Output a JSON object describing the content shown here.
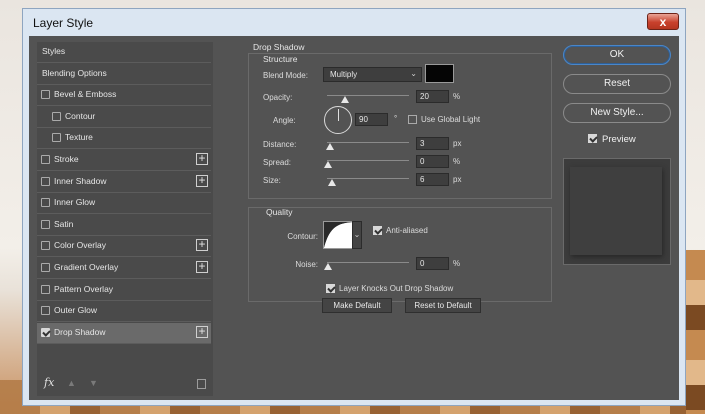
{
  "window": {
    "title": "Layer Style",
    "close_label": "x"
  },
  "styles_panel": {
    "items": [
      {
        "label": "Styles",
        "has_checkbox": false,
        "checked": false,
        "has_plus": false,
        "indent": false,
        "selected": false
      },
      {
        "label": "Blending Options",
        "has_checkbox": false,
        "checked": false,
        "has_plus": false,
        "indent": false,
        "selected": false
      },
      {
        "label": "Bevel & Emboss",
        "has_checkbox": true,
        "checked": false,
        "has_plus": false,
        "indent": false,
        "selected": false
      },
      {
        "label": "Contour",
        "has_checkbox": true,
        "checked": false,
        "has_plus": false,
        "indent": true,
        "selected": false
      },
      {
        "label": "Texture",
        "has_checkbox": true,
        "checked": false,
        "has_plus": false,
        "indent": true,
        "selected": false
      },
      {
        "label": "Stroke",
        "has_checkbox": true,
        "checked": false,
        "has_plus": true,
        "indent": false,
        "selected": false
      },
      {
        "label": "Inner Shadow",
        "has_checkbox": true,
        "checked": false,
        "has_plus": true,
        "indent": false,
        "selected": false
      },
      {
        "label": "Inner Glow",
        "has_checkbox": true,
        "checked": false,
        "has_plus": false,
        "indent": false,
        "selected": false
      },
      {
        "label": "Satin",
        "has_checkbox": true,
        "checked": false,
        "has_plus": false,
        "indent": false,
        "selected": false
      },
      {
        "label": "Color Overlay",
        "has_checkbox": true,
        "checked": false,
        "has_plus": true,
        "indent": false,
        "selected": false
      },
      {
        "label": "Gradient Overlay",
        "has_checkbox": true,
        "checked": false,
        "has_plus": true,
        "indent": false,
        "selected": false
      },
      {
        "label": "Pattern Overlay",
        "has_checkbox": true,
        "checked": false,
        "has_plus": false,
        "indent": false,
        "selected": false
      },
      {
        "label": "Outer Glow",
        "has_checkbox": true,
        "checked": false,
        "has_plus": false,
        "indent": false,
        "selected": false
      },
      {
        "label": "Drop Shadow",
        "has_checkbox": true,
        "checked": true,
        "has_plus": true,
        "indent": false,
        "selected": true
      }
    ],
    "fx_label": "fx"
  },
  "drop_shadow": {
    "title": "Drop Shadow",
    "structure_title": "Structure",
    "blend_mode_label": "Blend Mode:",
    "blend_mode_value": "Multiply",
    "shadow_color": "#050505",
    "opacity_label": "Opacity:",
    "opacity_value": "20",
    "opacity_unit": "%",
    "angle_label": "Angle:",
    "angle_value": "90",
    "angle_unit": "°",
    "use_global_light_label": "Use Global Light",
    "use_global_light_checked": false,
    "distance_label": "Distance:",
    "distance_value": "3",
    "distance_unit": "px",
    "spread_label": "Spread:",
    "spread_value": "0",
    "spread_unit": "%",
    "size_label": "Size:",
    "size_value": "6",
    "size_unit": "px",
    "quality_title": "Quality",
    "contour_label": "Contour:",
    "anti_aliased_label": "Anti-aliased",
    "anti_aliased_checked": true,
    "noise_label": "Noise:",
    "noise_value": "0",
    "noise_unit": "%",
    "knocks_out_label": "Layer Knocks Out Drop Shadow",
    "knocks_out_checked": true,
    "make_default_label": "Make Default",
    "reset_default_label": "Reset to Default"
  },
  "actions": {
    "ok_label": "OK",
    "reset_label": "Reset",
    "new_style_label": "New Style...",
    "preview_label": "Preview",
    "preview_checked": true
  },
  "colors": {
    "dialog_bg": "#535353",
    "list_bg": "#4a4a4a",
    "selected_row": "#6a6a6a",
    "ok_outline": "#4a86c8",
    "close_red": "#c8412d"
  }
}
